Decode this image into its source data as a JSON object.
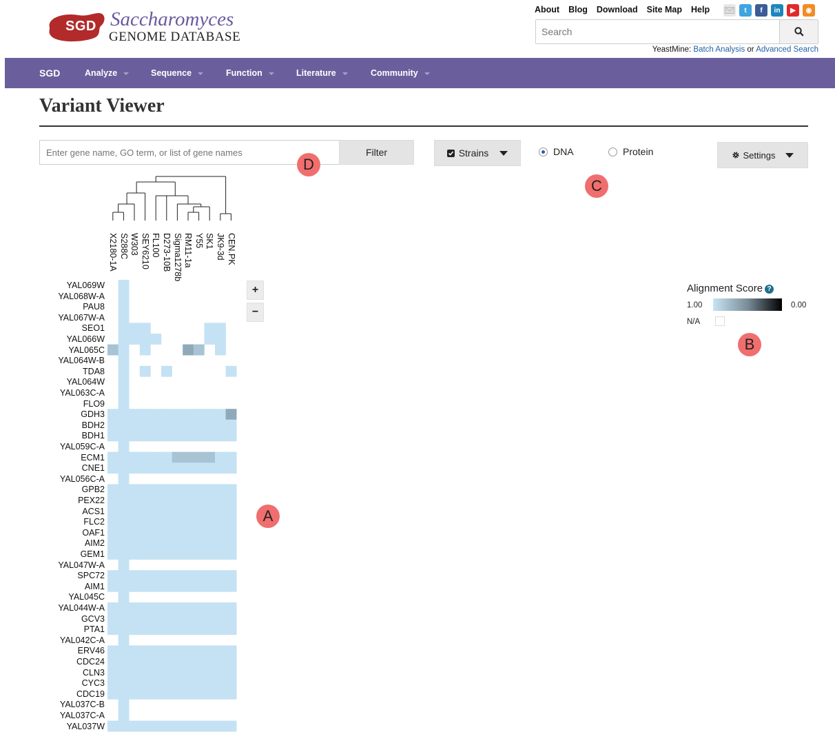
{
  "header": {
    "logo_badge": "SGD",
    "logo_title": "Saccharomyces",
    "logo_subtitle": "GENOME DATABASE",
    "top_links": [
      "About",
      "Blog",
      "Download",
      "Site Map",
      "Help"
    ],
    "social_icons": [
      "mail-icon",
      "twitter-icon",
      "facebook-icon",
      "linkedin-icon",
      "youtube-icon",
      "rss-icon"
    ],
    "search_placeholder": "Search",
    "yeastmine_label": "YeastMine:",
    "yeastmine_link1": "Batch Analysis",
    "yeastmine_or": "or",
    "yeastmine_link2": "Advanced Search"
  },
  "nav": {
    "home": "SGD",
    "items": [
      "Analyze",
      "Sequence",
      "Function",
      "Literature",
      "Community"
    ]
  },
  "page": {
    "title": "Variant Viewer"
  },
  "controls": {
    "gene_input_placeholder": "Enter gene name, GO term, or list of gene names",
    "filter_label": "Filter",
    "strains_label": "Strains",
    "dna_label": "DNA",
    "protein_label": "Protein",
    "settings_label": "Settings",
    "selected_mode": "DNA"
  },
  "legend": {
    "title": "Alignment Score",
    "max_label": "1.00",
    "min_label": "0.00",
    "na_label": "N/A"
  },
  "zoom": {
    "in": "+",
    "out": "−"
  },
  "markers": [
    "A",
    "B",
    "C",
    "D"
  ],
  "colors": {
    "nav": "#6a5f9c",
    "brand_red": "#b22a2a",
    "cell_light": "#c4e2f3",
    "cell_dark": "#8fa9b9",
    "marker": "#f06e6e"
  },
  "heatmap": {
    "strains": [
      "X2180-1A",
      "S288C",
      "W303",
      "SEY6210",
      "FL100",
      "D273-10B",
      "Sigma1278b",
      "RM11-1a",
      "Y55",
      "SK1",
      "JK9-3d",
      "CEN.PK"
    ],
    "genes": [
      {
        "name": "YAL069W",
        "row": "0100000000000"
      },
      {
        "name": "YAL068W-A",
        "row": "0100000000000"
      },
      {
        "name": "PAU8",
        "row": "0100000000000"
      },
      {
        "name": "YAL067W-A",
        "row": "0100000000000"
      },
      {
        "name": "SEO1",
        "row": "011100000110"
      },
      {
        "name": "YAL066W",
        "row": "011110000110"
      },
      {
        "name": "YAL065C",
        "row": "210100032010"
      },
      {
        "name": "YAL064W-B",
        "row": "0100000000000"
      },
      {
        "name": "TDA8",
        "row": "010101000001"
      },
      {
        "name": "YAL064W",
        "row": "0100000000000"
      },
      {
        "name": "YAL063C-A",
        "row": "0100000000000"
      },
      {
        "name": "FLO9",
        "row": "0100000000000"
      },
      {
        "name": "GDH3",
        "row": "111111111113"
      },
      {
        "name": "BDH2",
        "row": "111111111111"
      },
      {
        "name": "BDH1",
        "row": "111111111111"
      },
      {
        "name": "YAL059C-A",
        "row": "0100000000000"
      },
      {
        "name": "ECM1",
        "row": "111111222211"
      },
      {
        "name": "CNE1",
        "row": "111111111111"
      },
      {
        "name": "YAL056C-A",
        "row": "0100000000000"
      },
      {
        "name": "GPB2",
        "row": "111111111111"
      },
      {
        "name": "PEX22",
        "row": "111111111111"
      },
      {
        "name": "ACS1",
        "row": "111111111111"
      },
      {
        "name": "FLC2",
        "row": "111111111111"
      },
      {
        "name": "OAF1",
        "row": "111111111111"
      },
      {
        "name": "AIM2",
        "row": "111111111111"
      },
      {
        "name": "GEM1",
        "row": "111111111111"
      },
      {
        "name": "YAL047W-A",
        "row": "0100000000000"
      },
      {
        "name": "SPC72",
        "row": "111111111111"
      },
      {
        "name": "AIM1",
        "row": "111111111111"
      },
      {
        "name": "YAL045C",
        "row": "0100000000000"
      },
      {
        "name": "YAL044W-A",
        "row": "111111111111"
      },
      {
        "name": "GCV3",
        "row": "111111111111"
      },
      {
        "name": "PTA1",
        "row": "111111111111"
      },
      {
        "name": "YAL042C-A",
        "row": "0100000000000"
      },
      {
        "name": "ERV46",
        "row": "111111111111"
      },
      {
        "name": "CDC24",
        "row": "111111111111"
      },
      {
        "name": "CLN3",
        "row": "111111111111"
      },
      {
        "name": "CYC3",
        "row": "111111111111"
      },
      {
        "name": "CDC19",
        "row": "111111111111"
      },
      {
        "name": "YAL037C-B",
        "row": "0100000000000"
      },
      {
        "name": "YAL037C-A",
        "row": "0100000000000"
      },
      {
        "name": "YAL037W",
        "row": "111111111111"
      }
    ]
  }
}
